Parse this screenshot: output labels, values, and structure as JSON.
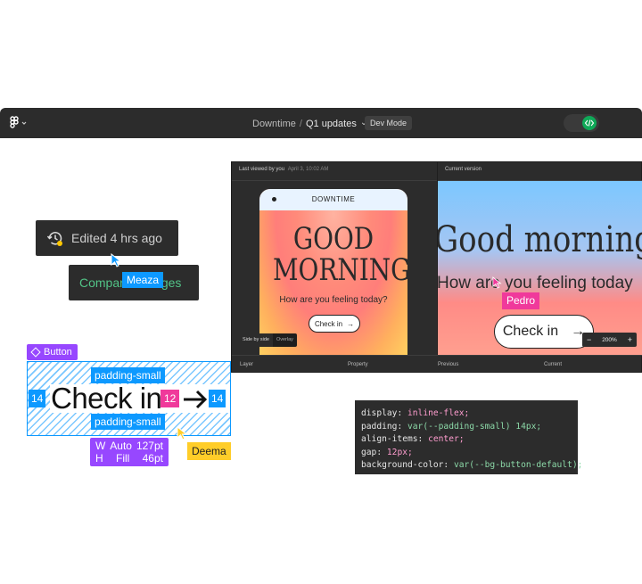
{
  "topbar": {
    "project": "Downtime",
    "separator": "/",
    "file": "Q1 updates",
    "chevron": "⌄",
    "dev_mode": "Dev Mode",
    "toggle_icon": "code-toggle-icon",
    "colors": {
      "bar": "#2c2c2c",
      "toggle": "#0fa958"
    }
  },
  "history": {
    "edited": "Edited 4 hrs ago",
    "compare": "Compare changes",
    "cursor_meaza": "Meaza"
  },
  "button_spec": {
    "component": "Button",
    "padding_top": "padding-small",
    "padding_bottom": "padding-small",
    "left": "14",
    "right": "14",
    "gap": "12",
    "text": "Check in",
    "arrow": "→",
    "w_label": "W",
    "w_mode": "Auto",
    "w_value": "127pt",
    "h_label": "H",
    "h_mode": "Fill",
    "h_value": "46pt",
    "cursor_deema": "Deema"
  },
  "compare_panel": {
    "last_viewed": "Last viewed by you",
    "last_viewed_date": "April 3, 10:02 AM",
    "current_version": "Current version",
    "phone_brand": "DOWNTIME",
    "greeting_line1": "GOOD",
    "greeting_line2": "MORNING",
    "question": "How are you feeling today?",
    "checkin": "Check in",
    "side_by_side": "Side by side",
    "overlay": "Overlay",
    "current_greeting": "Good morning",
    "current_question": "How are you feeling today",
    "current_checkin": "Check in",
    "cursor_pedro": "Pedro",
    "zoom_minus": "−",
    "zoom": "200%",
    "zoom_plus": "+",
    "table_headers": [
      "Layer",
      "Property",
      "Previous",
      "Current"
    ]
  },
  "code": {
    "lines": [
      {
        "prop": "display",
        "value": "inline-flex;"
      },
      {
        "prop": "padding",
        "value": "var(--padding-small) 14px;"
      },
      {
        "prop": "align-items",
        "value": "center;"
      },
      {
        "prop": "gap",
        "value": "12px;"
      },
      {
        "prop": "background-color",
        "value": "var(--bg-button-default);"
      }
    ]
  }
}
